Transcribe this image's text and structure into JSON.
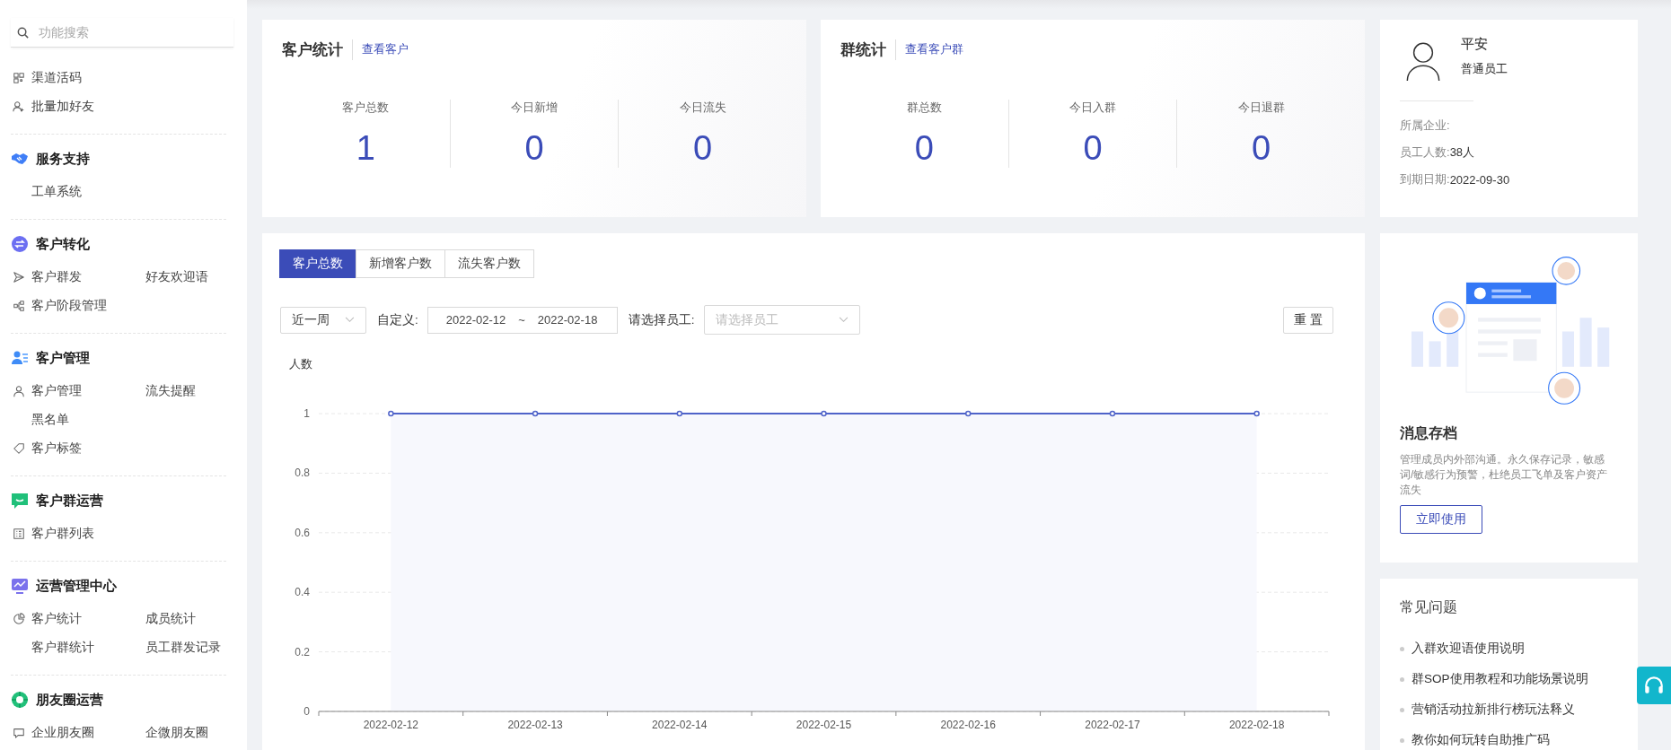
{
  "sidebar": {
    "search": {
      "placeholder": "功能搜索"
    },
    "groups": [
      {
        "rows": [
          [
            {
              "label": "渠道活码"
            }
          ],
          [
            {
              "label": "批量加好友"
            }
          ]
        ]
      },
      {
        "title": "服务支持",
        "rows": [
          [
            {
              "label": "工单系统"
            }
          ]
        ]
      },
      {
        "title": "客户转化",
        "rows": [
          [
            {
              "label": "客户群发"
            },
            {
              "label": "好友欢迎语"
            }
          ],
          [
            {
              "label": "客户阶段管理"
            }
          ]
        ]
      },
      {
        "title": "客户管理",
        "rows": [
          [
            {
              "label": "客户管理"
            },
            {
              "label": "流失提醒"
            }
          ],
          [
            {
              "label": "黑名单"
            }
          ],
          [
            {
              "label": "客户标签"
            }
          ]
        ]
      },
      {
        "title": "客户群运营",
        "rows": [
          [
            {
              "label": "客户群列表"
            }
          ]
        ]
      },
      {
        "title": "运营管理中心",
        "rows": [
          [
            {
              "label": "客户统计"
            },
            {
              "label": "成员统计"
            }
          ],
          [
            {
              "label": "客户群统计"
            },
            {
              "label": "员工群发记录"
            }
          ]
        ]
      },
      {
        "title": "朋友圈运营",
        "rows": [
          [
            {
              "label": "企业朋友圈"
            },
            {
              "label": "企微朋友圈"
            }
          ]
        ]
      }
    ]
  },
  "stat_cards": [
    {
      "title": "客户统计",
      "link": "查看客户",
      "metrics": [
        {
          "label": "客户总数",
          "value": "1"
        },
        {
          "label": "今日新增",
          "value": "0"
        },
        {
          "label": "今日流失",
          "value": "0"
        }
      ]
    },
    {
      "title": "群统计",
      "link": "查看客户群",
      "metrics": [
        {
          "label": "群总数",
          "value": "0"
        },
        {
          "label": "今日入群",
          "value": "0"
        },
        {
          "label": "今日退群",
          "value": "0"
        }
      ]
    }
  ],
  "chart_panel": {
    "tabs": [
      {
        "label": "客户总数",
        "selected": true
      },
      {
        "label": "新增客户数",
        "selected": false
      },
      {
        "label": "流失客户数",
        "selected": false
      }
    ],
    "period_select": {
      "value": "近一周"
    },
    "custom_label": "自定义:",
    "date_range": {
      "start": "2022-02-12",
      "separator": "~",
      "end": "2022-02-18"
    },
    "employee_label": "请选择员工:",
    "employee_select": {
      "placeholder": "请选择员工"
    },
    "reset_button": "重 置",
    "chart_data": {
      "type": "area",
      "ylabel": "人数",
      "categories": [
        "2022-02-12",
        "2022-02-13",
        "2022-02-14",
        "2022-02-15",
        "2022-02-16",
        "2022-02-17",
        "2022-02-18"
      ],
      "values": [
        1,
        1,
        1,
        1,
        1,
        1,
        1
      ],
      "ylim": [
        0,
        1
      ],
      "grid": true,
      "yticks": [
        0,
        0.2,
        0.4,
        0.6,
        0.8,
        1
      ]
    }
  },
  "profile": {
    "name": "平安",
    "role": "普通员工",
    "fields": [
      {
        "label": "所属企业:"
      },
      {
        "label": "员工人数:",
        "value": "38人"
      },
      {
        "label": "到期日期:",
        "value": "2022-09-30"
      }
    ]
  },
  "promo": {
    "title": "消息存档",
    "description": "管理成员内外部沟通。永久保存记录，敏感词/敏感行为预警，杜绝员工飞单及客户资产流失",
    "button": "立即使用"
  },
  "faq": {
    "title": "常见问题",
    "items": [
      "入群欢迎语使用说明",
      "群SOP使用教程和功能场景说明",
      "营销活动拉新排行榜玩法释义",
      "教你如何玩转自助推广码"
    ]
  }
}
